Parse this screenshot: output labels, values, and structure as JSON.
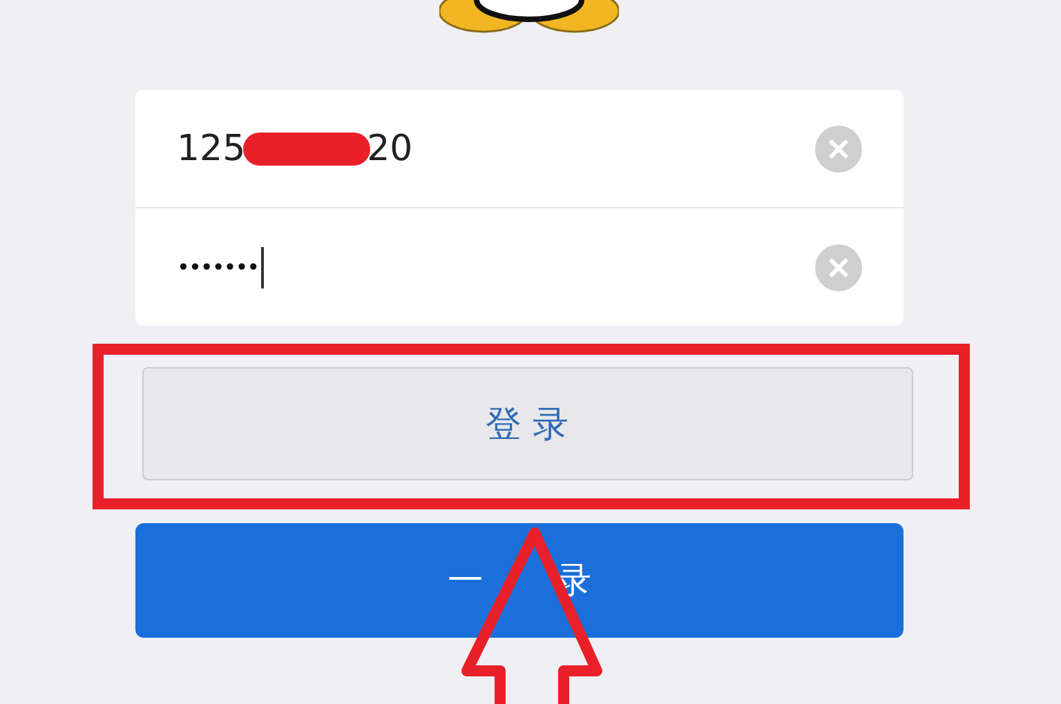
{
  "account": {
    "value_start": "125",
    "value_end": "20",
    "redacted": true
  },
  "password": {
    "value": "•••••••",
    "focused": true
  },
  "login_button": {
    "label": "登 录",
    "highlighted": true
  },
  "quick_login_button": {
    "label_visible_start": "一",
    "label_visible_end": "录"
  }
}
